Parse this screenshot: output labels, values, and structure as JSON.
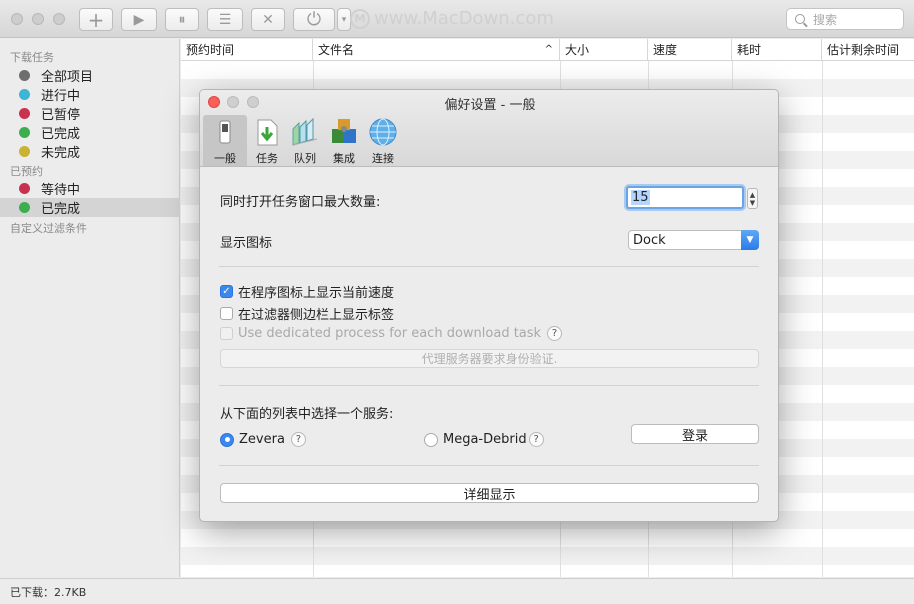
{
  "toolbar": {
    "watermark_icon": "M",
    "watermark_text": "www.MacDown.com",
    "search_placeholder": "搜索",
    "buttons": {
      "add": "+",
      "play": "▶",
      "pause": "⏸",
      "list": "☰",
      "remove": "✕",
      "power": "⏻"
    }
  },
  "sidebar": {
    "downloads_header": "下载任务",
    "download_items": [
      {
        "label": "全部项目",
        "color": "#6e6e6e"
      },
      {
        "label": "进行中",
        "color": "#3bb6d6"
      },
      {
        "label": "已暂停",
        "color": "#c9314f"
      },
      {
        "label": "已完成",
        "color": "#3cae4e"
      },
      {
        "label": "未完成",
        "color": "#c9b234"
      }
    ],
    "scheduled_header": "已预约",
    "scheduled_items": [
      {
        "label": "等待中",
        "color": "#c9314f"
      },
      {
        "label": "已完成",
        "color": "#3cae4e"
      }
    ],
    "custom_filter": "自定义过滤条件"
  },
  "table": {
    "columns": [
      "预约时间",
      "文件名",
      "大小",
      "速度",
      "耗时",
      "估计剩余时间"
    ],
    "sort_indicator": "^"
  },
  "status": {
    "downloaded": "已下载：2.7KB"
  },
  "dialog": {
    "title": "偏好设置 - 一般",
    "tabs": [
      "一般",
      "任务",
      "队列",
      "集成",
      "连接"
    ],
    "max_windows_label": "同时打开任务窗口最大数量:",
    "max_windows_value": "15",
    "show_icon_label": "显示图标",
    "show_icon_value": "Dock",
    "check_speed": "在程序图标上显示当前速度",
    "check_tags": "在过滤器侧边栏上显示标签",
    "check_dedicated": "Use dedicated process for each download task",
    "proxy_button": "代理服务器要求身份验证.",
    "service_label": "从下面的列表中选择一个服务:",
    "service_zevera": "Zevera",
    "service_mega": "Mega-Debrid",
    "help_glyph": "?",
    "login_button": "登录",
    "details_button": "详细显示"
  }
}
